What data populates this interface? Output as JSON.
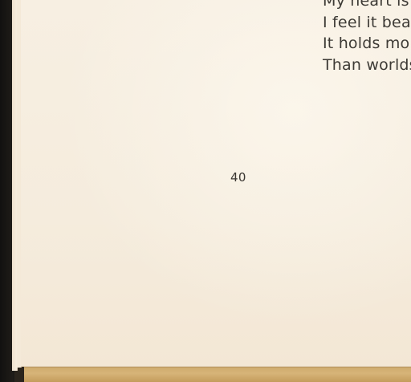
{
  "poem": {
    "lines": [
      "My heart is",
      "I feel it bea",
      "It holds mor",
      "Than worlds"
    ]
  },
  "page": {
    "number": "40"
  }
}
